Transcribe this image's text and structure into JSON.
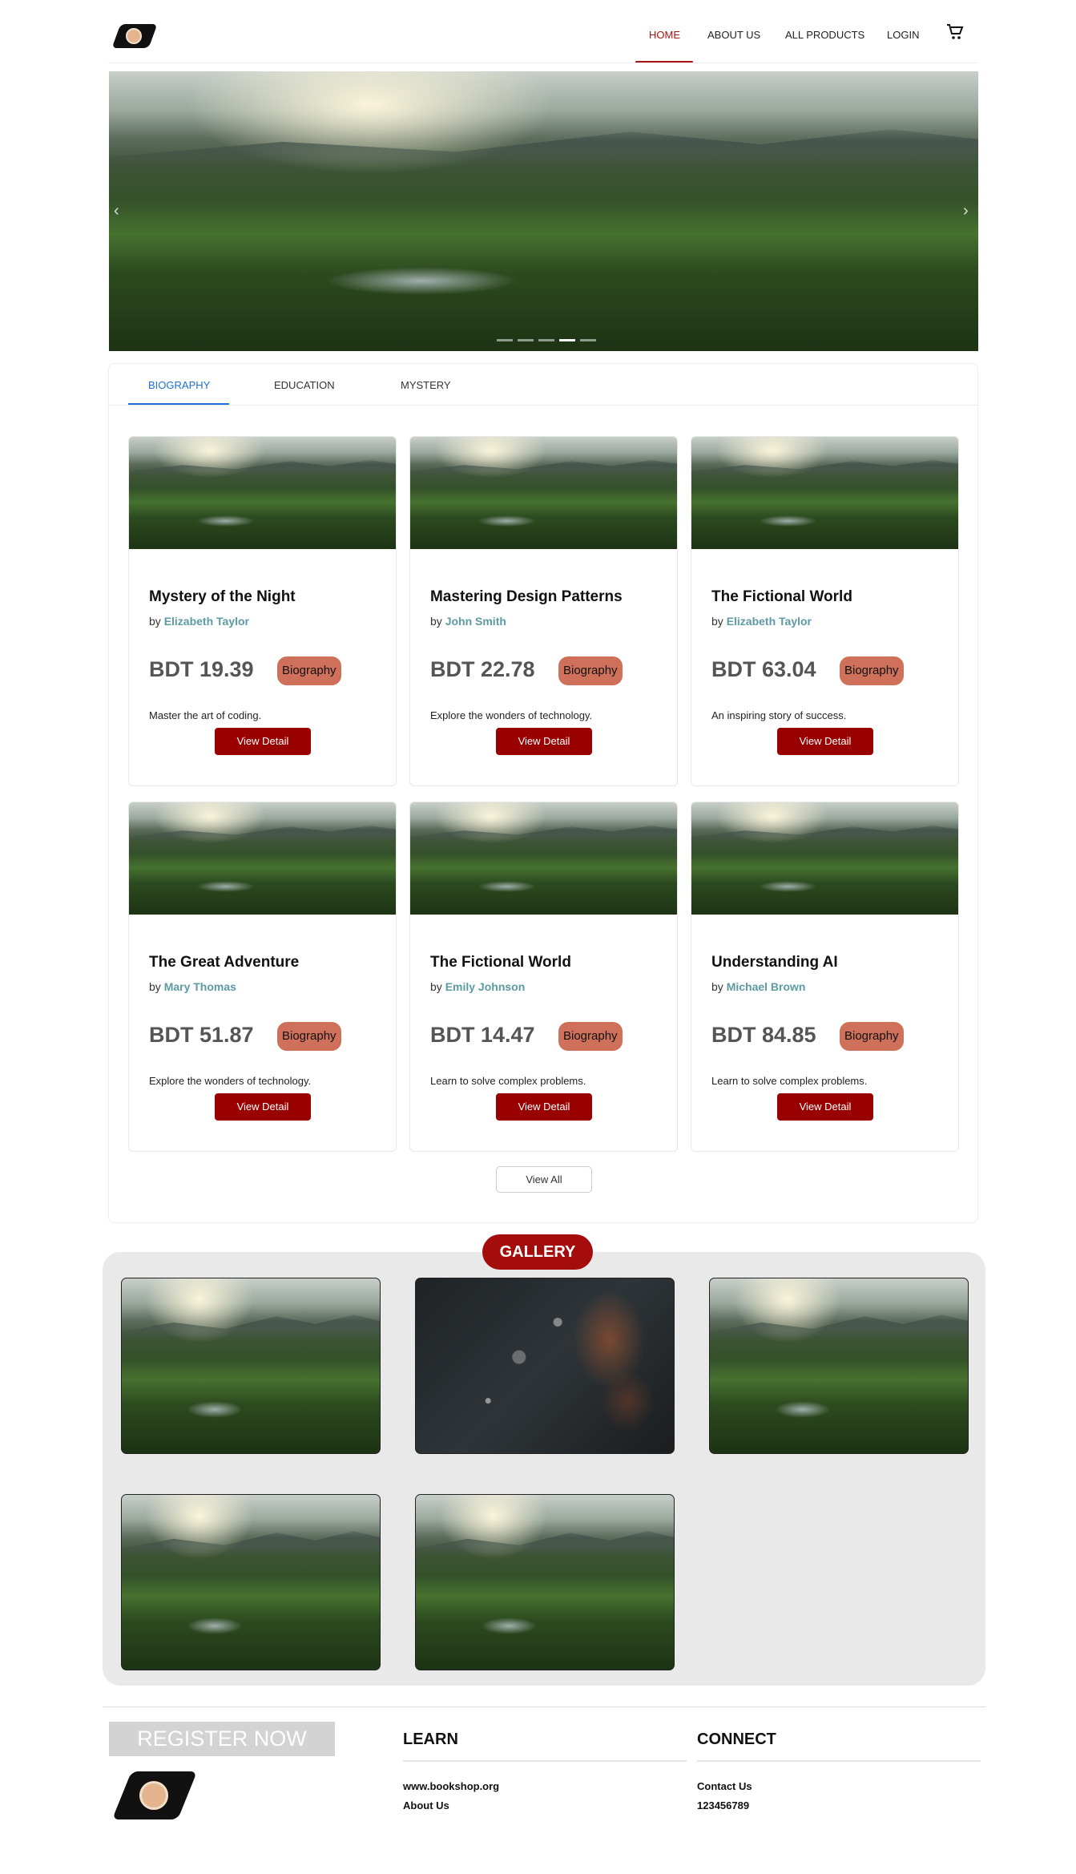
{
  "header": {
    "logo_icon": "bookshop-logo-icon",
    "nav": [
      "HOME",
      "ABOUT US",
      "ALL PRODUCTS",
      "LOGIN"
    ],
    "active_nav": "HOME",
    "cart_icon": "cart-icon"
  },
  "carousel": {
    "prev_icon": "chevron-left-icon",
    "next_icon": "chevron-right-icon",
    "slide_count": 5,
    "active_slide": 4
  },
  "tabs": [
    "BIOGRAPHY",
    "EDUCATION",
    "MYSTERY"
  ],
  "active_tab": "BIOGRAPHY",
  "books": [
    {
      "title": "Mystery of the Night",
      "by": "by",
      "author": "Elizabeth Taylor",
      "price": "BDT 19.39",
      "category": "Biography",
      "description": "Master the art of coding.",
      "button": "View Detail"
    },
    {
      "title": "Mastering Design Patterns",
      "by": "by",
      "author": "John Smith",
      "price": "BDT 22.78",
      "category": "Biography",
      "description": "Explore the wonders of technology.",
      "button": "View Detail"
    },
    {
      "title": "The Fictional World",
      "by": "by",
      "author": "Elizabeth Taylor",
      "price": "BDT 63.04",
      "category": "Biography",
      "description": "An inspiring story of success.",
      "button": "View Detail"
    },
    {
      "title": "The Great Adventure",
      "by": "by",
      "author": "Mary Thomas",
      "price": "BDT 51.87",
      "category": "Biography",
      "description": "Explore the wonders of technology.",
      "button": "View Detail"
    },
    {
      "title": "The Fictional World",
      "by": "by",
      "author": "Emily Johnson",
      "price": "BDT 14.47",
      "category": "Biography",
      "description": "Learn to solve complex problems.",
      "button": "View Detail"
    },
    {
      "title": "Understanding AI",
      "by": "by",
      "author": "Michael Brown",
      "price": "BDT 84.85",
      "category": "Biography",
      "description": "Learn to solve complex problems.",
      "button": "View Detail"
    }
  ],
  "view_all": "View All",
  "gallery": {
    "title": "GALLERY",
    "images": [
      "landscape",
      "dark-bokeh",
      "landscape",
      "landscape",
      "landscape"
    ]
  },
  "footer": {
    "register": "REGISTER NOW",
    "learn_heading": "LEARN",
    "learn_links": [
      "www.bookshop.org",
      "About Us"
    ],
    "connect_heading": "CONNECT",
    "connect_links": [
      "Contact Us",
      "123456789"
    ]
  },
  "colors": {
    "accent": "#990000",
    "active_nav": "#a61414",
    "tab_active": "#1f6fd1",
    "author": "#5e9aa3",
    "badge": "#cf705a",
    "gallery_bg": "#e9e9e9"
  }
}
